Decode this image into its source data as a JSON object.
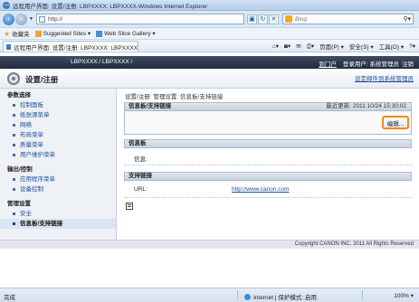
{
  "window": {
    "title": "远程用户界面: 设置/注册: LBPXXXX: LBPXXXX-Windows Internet Explorer"
  },
  "addressbar": {
    "url": "http://",
    "search_placeholder": "Bing"
  },
  "favorites": {
    "label": "收藏夹",
    "items": [
      {
        "label": "Suggested Sites ▾"
      },
      {
        "label": "Web Slice Gallery ▾"
      }
    ]
  },
  "tab": {
    "label": "远程用户界面: 设置/注册: LBPXXXX: LBPXXXX"
  },
  "commands": {
    "page": "页面(P) ▾",
    "safety": "安全(S) ▾",
    "tools": "工具(O) ▾",
    "help": "?▾"
  },
  "app": {
    "device_name": "LBPXXXX / LBPXXXX /",
    "portal_link": "到门户",
    "login_user": "登录用户: 系统管理员",
    "logout": "注销",
    "page_title": "设置/注册",
    "mail_settings": "设定邮件到系统管理员"
  },
  "sidebar": {
    "groups": [
      {
        "label": "参数选择",
        "items": [
          "控制面板",
          "纸张源菜单",
          "网络",
          "布局菜单",
          "质量菜单",
          "用户维护菜单"
        ]
      },
      {
        "label": "输出/控制",
        "items": [
          "应用程序菜单",
          "设备控制"
        ]
      },
      {
        "label": "管理设置",
        "items": [
          "安全",
          "信息板/支持链接"
        ]
      }
    ],
    "active_item": "信息板/支持链接"
  },
  "main": {
    "breadcrumb": "设置/注册: 管理设置: 信息板/支持链接",
    "section_title": "信息板/支持链接",
    "last_updated": "最近更新: 2011 10/24 15:30:02",
    "edit_button": "编辑...",
    "info_board_title": "信息板",
    "info_label": "信息:",
    "support_title": "支持链接",
    "url_label": "URL:",
    "url_value": "http://www.canon.com"
  },
  "footer": {
    "copyright": "Copyright CANON INC. 2011 All Rights Reserved"
  },
  "status": {
    "done": "完成",
    "zone": "Internet | 保护模式: 启用",
    "zoom": "100%  ▾"
  },
  "colors": {
    "app_header": "#2c3a50",
    "edit_highlight": "#f08a1c",
    "link": "#1a4e9c"
  }
}
